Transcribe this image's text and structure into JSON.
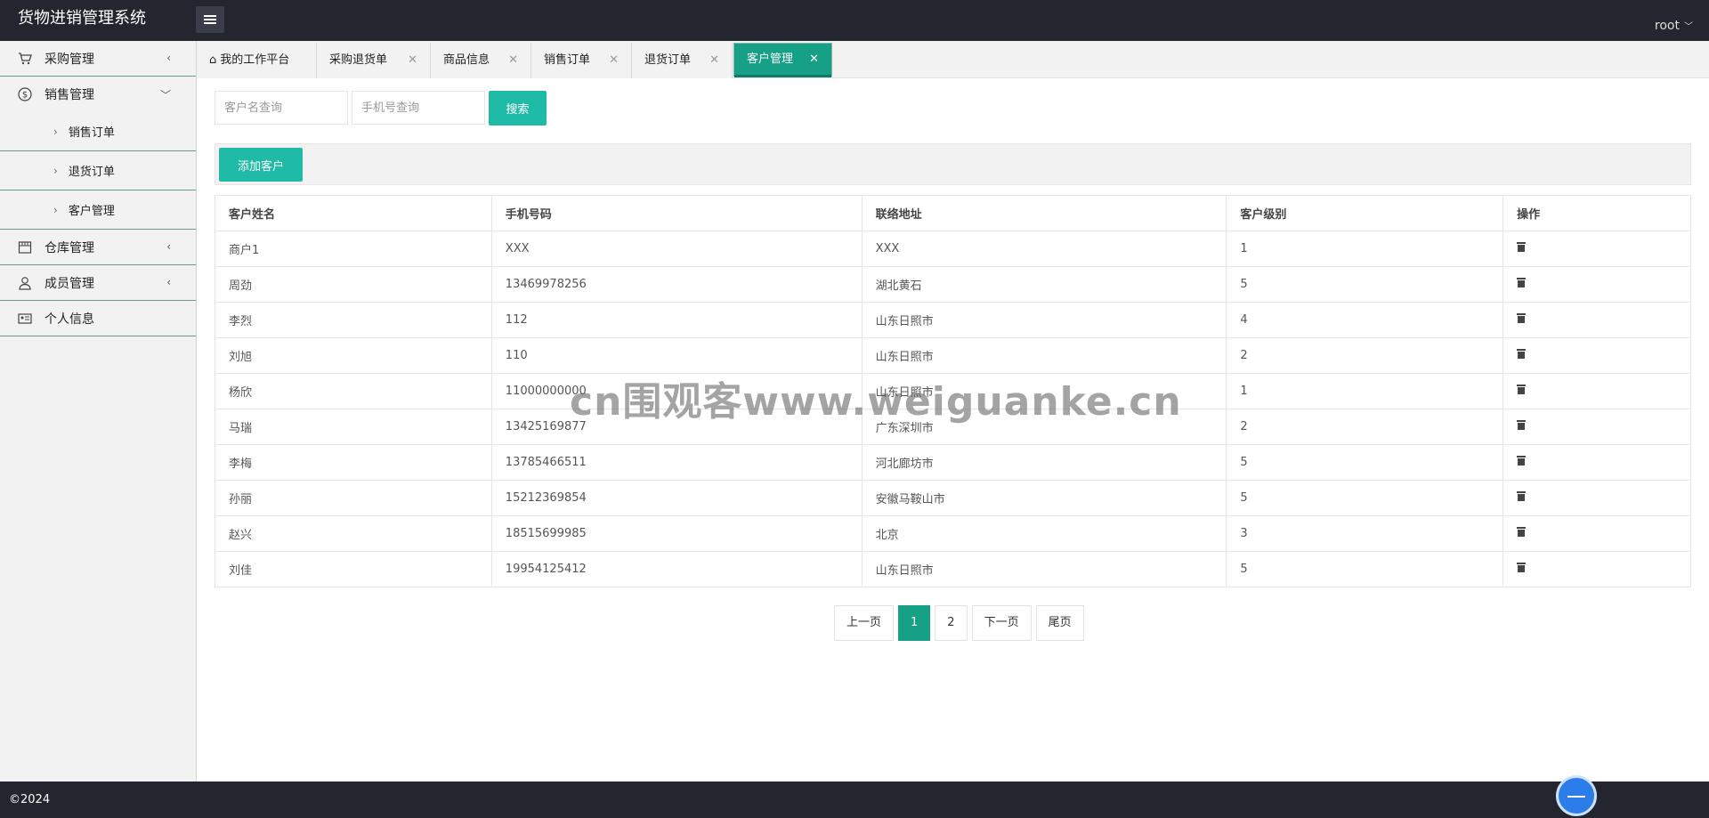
{
  "header": {
    "app_title": "货物进销管理系统",
    "user_name": "root"
  },
  "sidebar": {
    "items": [
      {
        "label": "采购管理"
      },
      {
        "label": "销售管理",
        "children": [
          {
            "label": "销售订单"
          },
          {
            "label": "退货订单"
          },
          {
            "label": "客户管理"
          }
        ]
      },
      {
        "label": "仓库管理"
      },
      {
        "label": "成员管理"
      },
      {
        "label": "个人信息"
      }
    ]
  },
  "tabs": [
    {
      "label": "我的工作平台"
    },
    {
      "label": "采购退货单"
    },
    {
      "label": "商品信息"
    },
    {
      "label": "销售订单"
    },
    {
      "label": "退货订单"
    },
    {
      "label": "客户管理",
      "active": true
    }
  ],
  "search": {
    "name_placeholder": "客户名查询",
    "phone_placeholder": "手机号查询",
    "button_label": "搜索"
  },
  "toolbar": {
    "add_label": "添加客户"
  },
  "table": {
    "columns": [
      "客户姓名",
      "手机号码",
      "联络地址",
      "客户级别",
      "操作"
    ],
    "rows": [
      {
        "name": "商户1",
        "phone": "XXX",
        "address": "XXX",
        "level": "1"
      },
      {
        "name": "周劲",
        "phone": "13469978256",
        "address": "湖北黄石",
        "level": "5"
      },
      {
        "name": "李烈",
        "phone": "112",
        "address": "山东日照市",
        "level": "4"
      },
      {
        "name": "刘旭",
        "phone": "110",
        "address": "山东日照市",
        "level": "2"
      },
      {
        "name": "杨欣",
        "phone": "11000000000",
        "address": "山东日照市",
        "level": "1"
      },
      {
        "name": "马瑞",
        "phone": "13425169877",
        "address": "广东深圳市",
        "level": "2"
      },
      {
        "name": "李梅",
        "phone": "13785466511",
        "address": "河北廊坊市",
        "level": "5"
      },
      {
        "name": "孙丽",
        "phone": "15212369854",
        "address": "安徽马鞍山市",
        "level": "5"
      },
      {
        "name": "赵兴",
        "phone": "18515699985",
        "address": "北京",
        "level": "3"
      },
      {
        "name": "刘佳",
        "phone": "19954125412",
        "address": "山东日照市",
        "level": "5"
      }
    ]
  },
  "pagination": {
    "prev": "上一页",
    "pages": [
      "1",
      "2"
    ],
    "current": "1",
    "next": "下一页",
    "last": "尾页"
  },
  "watermark": "cn围观客www.weiguanke.cn",
  "footer": {
    "copyright": "©2024"
  }
}
